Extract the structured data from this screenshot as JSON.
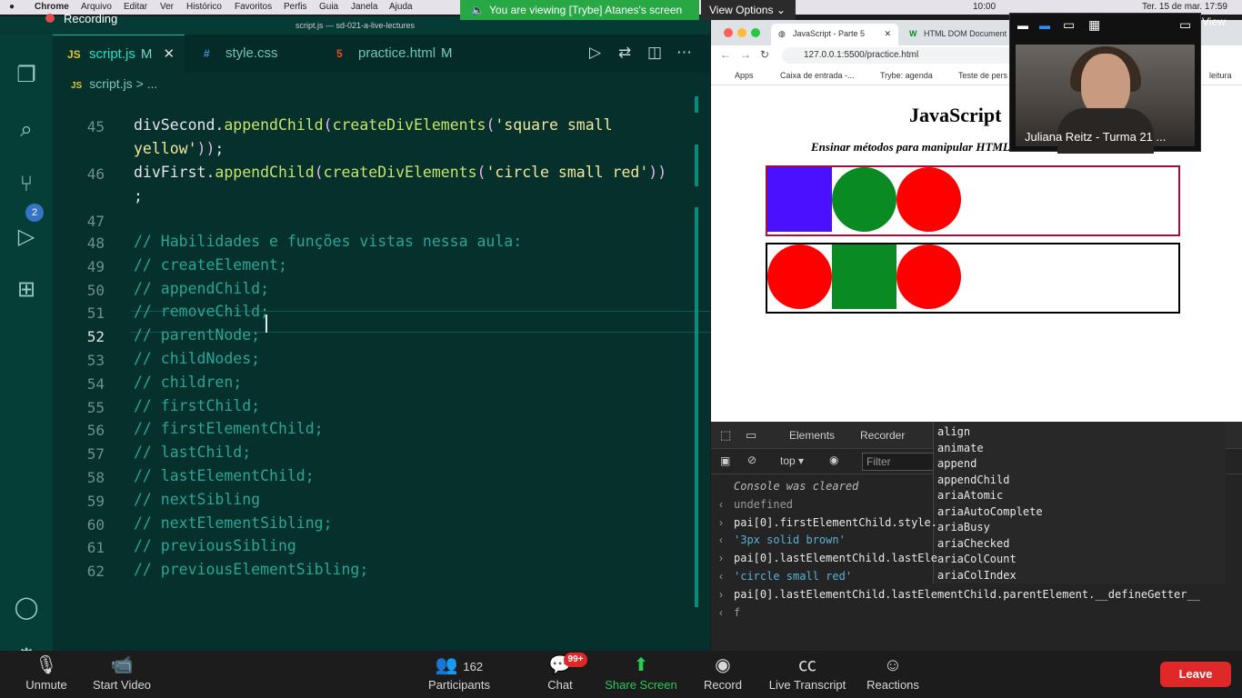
{
  "mac_menu": {
    "items": [
      "Chrome",
      "Arquivo",
      "Editar",
      "Ver",
      "Histórico",
      "Favoritos",
      "Perfis",
      "Guia",
      "Janela",
      "Ajuda"
    ],
    "time": "10:00",
    "date": "Ter. 15 de mar.  17:59"
  },
  "zoom": {
    "recording": "Recording",
    "viewing": "You are viewing [Trybe] Atanes's screen",
    "view_options": "View Options",
    "participant_name": "Juliana Reitz - Turma 21 ...",
    "view_label": "View",
    "toolbar": {
      "unmute": "Unmute",
      "start_video": "Start Video",
      "participants": "Participants",
      "participants_count": "162",
      "chat": "Chat",
      "chat_badge": "99+",
      "share": "Share Screen",
      "record": "Record",
      "transcript": "Live Transcript",
      "reactions": "Reactions",
      "leave": "Leave"
    }
  },
  "vscode": {
    "window_title": "script.js — sd-021-a-live-lectures",
    "tabs": [
      {
        "label": "script.js",
        "icon": "JS",
        "modified": "M"
      },
      {
        "label": "style.css",
        "icon": "#",
        "modified": ""
      },
      {
        "label": "practice.html",
        "icon": "5",
        "modified": "M"
      }
    ],
    "breadcrumb_file": "script.js",
    "breadcrumb_rest": "> ...",
    "scm_badge": "2",
    "comment_lines": [
      {
        "n": "48",
        "text": "// Habilidades e funções vistas nessa aula:"
      },
      {
        "n": "49",
        "text": "// createElement;"
      },
      {
        "n": "50",
        "text": "// appendChild;"
      },
      {
        "n": "51",
        "text": "// removeChild;"
      },
      {
        "n": "52",
        "text": "// parentNode;"
      },
      {
        "n": "53",
        "text": "// childNodes;"
      },
      {
        "n": "54",
        "text": "// children;"
      },
      {
        "n": "55",
        "text": "// firstChild;"
      },
      {
        "n": "56",
        "text": "// firstElementChild;"
      },
      {
        "n": "57",
        "text": "// lastChild;"
      },
      {
        "n": "58",
        "text": "// lastElementChild;"
      },
      {
        "n": "59",
        "text": "// nextSibling"
      },
      {
        "n": "60",
        "text": "// nextElementSibling;"
      },
      {
        "n": "61",
        "text": "// previousSibling"
      },
      {
        "n": "62",
        "text": "// previousElementSibling;"
      }
    ],
    "line45": {
      "n": "45",
      "obj": "divSecond.",
      "method": "appendChild",
      "fn": "createDivElements",
      "arg": "'square small",
      "cont": "yellow'"
    },
    "line46": {
      "n": "46",
      "obj": "divFirst.",
      "method": "appendChild",
      "fn": "createDivElements",
      "arg": "'circle small red'"
    },
    "line47": "47",
    "current_line": "52"
  },
  "browser": {
    "tabs": [
      "JavaScript - Parte 5",
      "HTML DOM Document"
    ],
    "url": "127.0.0.1:5500/practice.html",
    "bookmarks": [
      "Apps",
      "Caixa de entrada -...",
      "Trybe: agenda",
      "Teste de pers",
      "leitura"
    ],
    "page_title": "JavaScript",
    "page_subtitle": "Ensinar métodos para manipular HTML"
  },
  "devtools": {
    "tabs": [
      "Elements",
      "Recorder"
    ],
    "context": "top",
    "filter_placeholder": "Filter",
    "console": [
      {
        "arrow": "",
        "text": "Console was cleared"
      },
      {
        "arrow": "‹",
        "text": "undefined"
      },
      {
        "arrow": "›",
        "text": "pai[0].firstElementChild.style."
      },
      {
        "arrow": "‹",
        "text": "'3px solid brown'"
      },
      {
        "arrow": "›",
        "text": "pai[0].lastElementChild.lastEle"
      },
      {
        "arrow": "‹",
        "text": "'circle small red'"
      },
      {
        "arrow": "›",
        "text": "pai[0].lastElementChild.lastElementChild.parentElement.__defineGetter__"
      },
      {
        "arrow": "‹",
        "text": "f"
      }
    ],
    "autocomplete": [
      "align",
      "animate",
      "append",
      "appendChild",
      "ariaAtomic",
      "ariaAutoComplete",
      "ariaBusy",
      "ariaChecked",
      "ariaColCount",
      "ariaColIndex"
    ]
  },
  "colors": {
    "blue_square": "#4a10ff",
    "green": "#0a8a22",
    "red": "#ff0000",
    "box1_border": "#a0103a"
  }
}
